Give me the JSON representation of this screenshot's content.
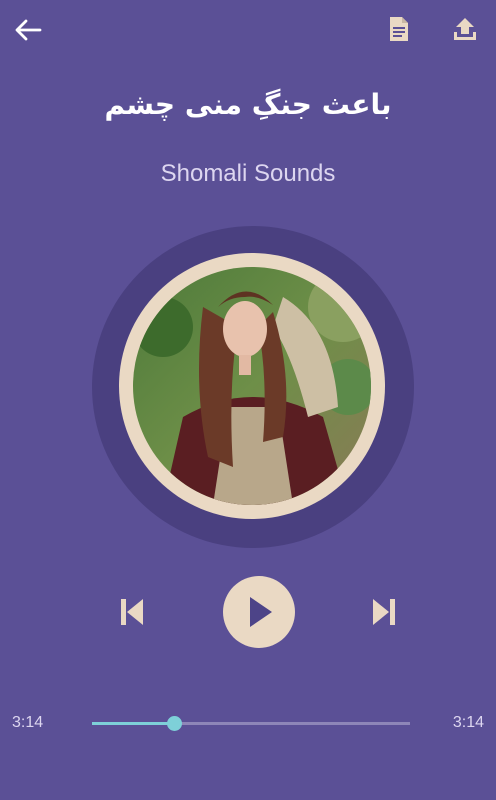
{
  "toolbar": {
    "back_icon": "arrow-left-icon",
    "doc_icon": "document-icon",
    "upload_icon": "upload-icon"
  },
  "song": {
    "title": "باعث جنگِ منی چشم",
    "artist": "Shomali Sounds"
  },
  "controls": {
    "prev_icon": "skip-previous-icon",
    "play_icon": "play-icon",
    "next_icon": "skip-next-icon"
  },
  "progress": {
    "current": "3:14",
    "total": "3:14",
    "fraction": 0.26
  },
  "colors": {
    "background": "#5b5096",
    "accent": "#7ed0d8",
    "cream": "#ead9c4"
  }
}
